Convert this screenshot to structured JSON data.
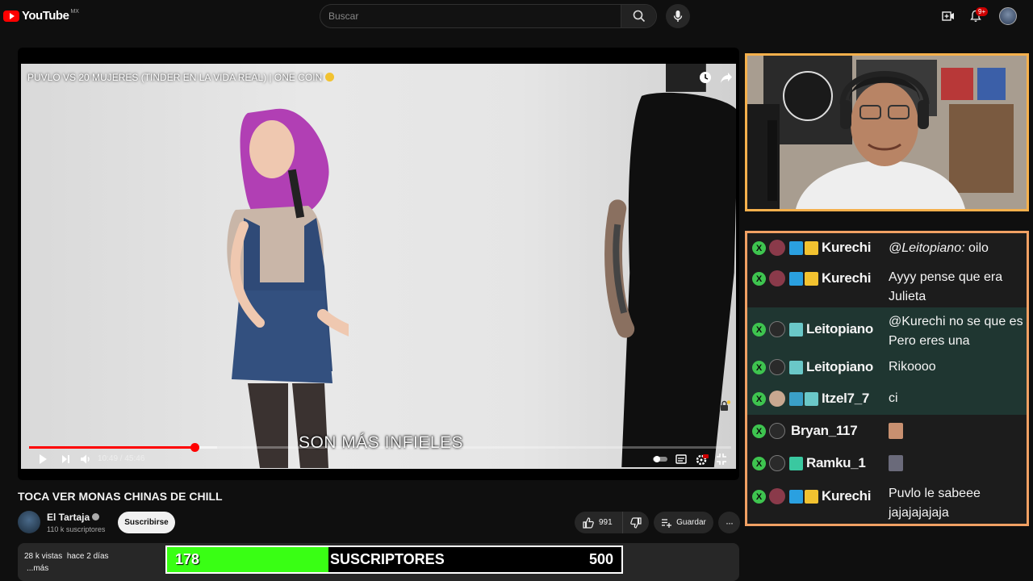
{
  "header": {
    "logo_text": "YouTube",
    "logo_region": "MX",
    "search_placeholder": "Buscar",
    "notifications_badge": "9+",
    "icons": [
      "create-icon",
      "bell-icon",
      "search-icon",
      "mic-icon"
    ]
  },
  "player": {
    "title": "PUVLO VS 20 MUJERES (TINDER EN LA VIDA REAL) | ONE COIN",
    "subtitle_text": "SON MÁS INFIELES",
    "time_current": "10:49",
    "time_separator": " / ",
    "time_total": "45:46",
    "progress_fraction": 0.236,
    "buffer_fraction": 0.268
  },
  "video_info": {
    "title": "TOCA VER MONAS CHINAS DE CHILL",
    "channel_name": "El Tartaja",
    "channel_subs": "110 k suscriptores",
    "subscribe_label": "Suscribirse",
    "like_count": "991",
    "save_label": "Guardar",
    "more_label": "···",
    "views": "28 k vistas",
    "age": "hace 2 días",
    "more_desc": "...más"
  },
  "goal_bar": {
    "current": "178",
    "label": "SUSCRIPTORES",
    "target": "500",
    "fill_fraction": 0.356,
    "fill_color": "#39ff14"
  },
  "chat": {
    "messages": [
      {
        "user": "Kurechi",
        "mention": "@Leitopiano:",
        "text": "oilo"
      },
      {
        "user": "Kurechi",
        "mention": "",
        "text": "Ayyy pense que era Julieta"
      },
      {
        "user": "Leitopiano",
        "mention": "",
        "text": "@Kurechi no se que es Pero eres una mamacita"
      },
      {
        "user": "Leitopiano",
        "mention": "",
        "text": "Rikoooo"
      },
      {
        "user": "Itzel7_7",
        "mention": "",
        "text": "ci"
      },
      {
        "user": "Bryan_117",
        "mention": "",
        "text": ""
      },
      {
        "user": "Ramku_1",
        "mention": "",
        "text": ""
      },
      {
        "user": "Kurechi",
        "mention": "",
        "text": "Puvlo le sabeee jajajajajaja"
      }
    ],
    "badge_letter": "X",
    "accent_color": "#f0a063",
    "alt_row_color": "#1f3631"
  }
}
